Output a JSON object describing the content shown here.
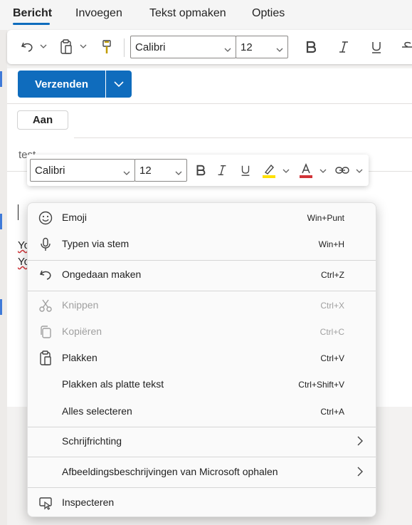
{
  "tabs": [
    {
      "label": "Bericht"
    },
    {
      "label": "Invoegen"
    },
    {
      "label": "Tekst opmaken"
    },
    {
      "label": "Opties"
    }
  ],
  "ribbon": {
    "font_name": "Calibri",
    "font_size": "12"
  },
  "compose": {
    "send_label": "Verzenden",
    "to_label": "Aan",
    "subject_fragment": "test",
    "body_fragment_1": "Yo",
    "body_fragment_2": "Yo"
  },
  "mini_toolbar": {
    "font_name": "Calibri",
    "font_size": "12",
    "highlight_color": "#ffe000",
    "font_color": "#d13438"
  },
  "context_menu": {
    "items": [
      {
        "label": "Emoji",
        "shortcut": "Win+Punt",
        "icon": "emoji-icon",
        "disabled": false
      },
      {
        "label": "Typen via stem",
        "shortcut": "Win+H",
        "icon": "microphone-icon",
        "disabled": false
      },
      {
        "label": "Ongedaan maken",
        "shortcut": "Ctrl+Z",
        "icon": "undo-icon",
        "disabled": false
      },
      {
        "label": "Knippen",
        "shortcut": "Ctrl+X",
        "icon": "scissors-icon",
        "disabled": true
      },
      {
        "label": "Kopiëren",
        "shortcut": "Ctrl+C",
        "icon": "copy-icon",
        "disabled": true
      },
      {
        "label": "Plakken",
        "shortcut": "Ctrl+V",
        "icon": "paste-icon",
        "disabled": false
      },
      {
        "label": "Plakken als platte tekst",
        "shortcut": "Ctrl+Shift+V",
        "icon": "",
        "disabled": false
      },
      {
        "label": "Alles selecteren",
        "shortcut": "Ctrl+A",
        "icon": "",
        "disabled": false
      },
      {
        "label": "Schrijfrichting",
        "shortcut": "",
        "icon": "",
        "disabled": false,
        "submenu": true
      },
      {
        "label": "Afbeeldingsbeschrijvingen van Microsoft ophalen",
        "shortcut": "",
        "icon": "",
        "disabled": false,
        "submenu": true
      },
      {
        "label": "Inspecteren",
        "shortcut": "",
        "icon": "inspect-icon",
        "disabled": false
      }
    ]
  },
  "colors": {
    "accent": "#0f6cbd",
    "highlight": "#ffe000",
    "font_red": "#d13438"
  }
}
